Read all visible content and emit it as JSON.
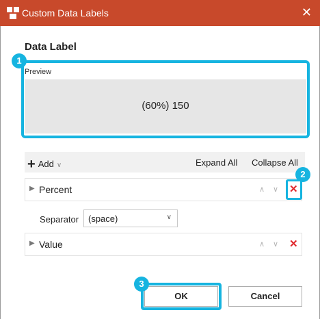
{
  "window": {
    "title": "Custom Data Labels",
    "close_glyph": "✕"
  },
  "section": {
    "title": "Data Label"
  },
  "preview": {
    "label": "Preview",
    "text": "(60%) 150"
  },
  "toolbar": {
    "add_label": "Add",
    "expand_all": "Expand All",
    "collapse_all": "Collapse All"
  },
  "items": [
    {
      "label": "Percent"
    },
    {
      "label": "Value"
    }
  ],
  "separator": {
    "label": "Separator",
    "value": "(space)"
  },
  "buttons": {
    "ok": "OK",
    "cancel": "Cancel"
  },
  "badges": [
    "1",
    "2",
    "3"
  ],
  "icons": {
    "app": "app-icon",
    "caret": "caret-right-icon",
    "up": "chevron-up-icon",
    "down": "chevron-down-icon",
    "delete": "delete-x-icon"
  },
  "colors": {
    "titlebar": "#c8492b",
    "highlight": "#16b4e0",
    "delete": "#e0262b"
  }
}
